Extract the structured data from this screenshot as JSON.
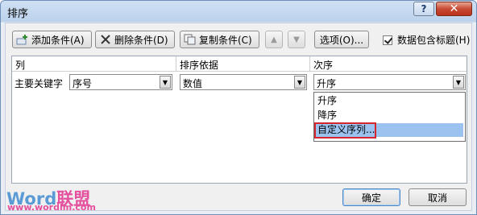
{
  "window": {
    "title": "排序",
    "help_label": "?",
    "close_label": "✕"
  },
  "toolbar": {
    "add_label": "添加条件(A)",
    "delete_label": "删除条件(D)",
    "copy_label": "复制条件(C)",
    "up_label": "▲",
    "down_label": "▼",
    "options_label": "选项(O)...",
    "header_checkbox_label": "数据包含标题(H)",
    "header_checkbox_checked": true
  },
  "grid": {
    "columns": [
      "列",
      "排序依据",
      "次序"
    ],
    "rows": [
      {
        "label": "主要关键字",
        "column": "序号",
        "sort_on": "数值",
        "order": "升序"
      }
    ]
  },
  "dropdown": {
    "items": [
      "升序",
      "降序",
      "自定义序列..."
    ],
    "selected_index": 2
  },
  "footer": {
    "ok_label": "确定",
    "cancel_label": "取消"
  },
  "watermark": {
    "brand_a": "Word",
    "brand_b": "联盟",
    "url": "www.wordlm.com"
  },
  "icons": [
    "add-condition-icon",
    "delete-condition-icon",
    "copy-condition-icon",
    "move-up-icon",
    "move-down-icon",
    "dropdown-arrow-icon",
    "checkmark-icon"
  ]
}
